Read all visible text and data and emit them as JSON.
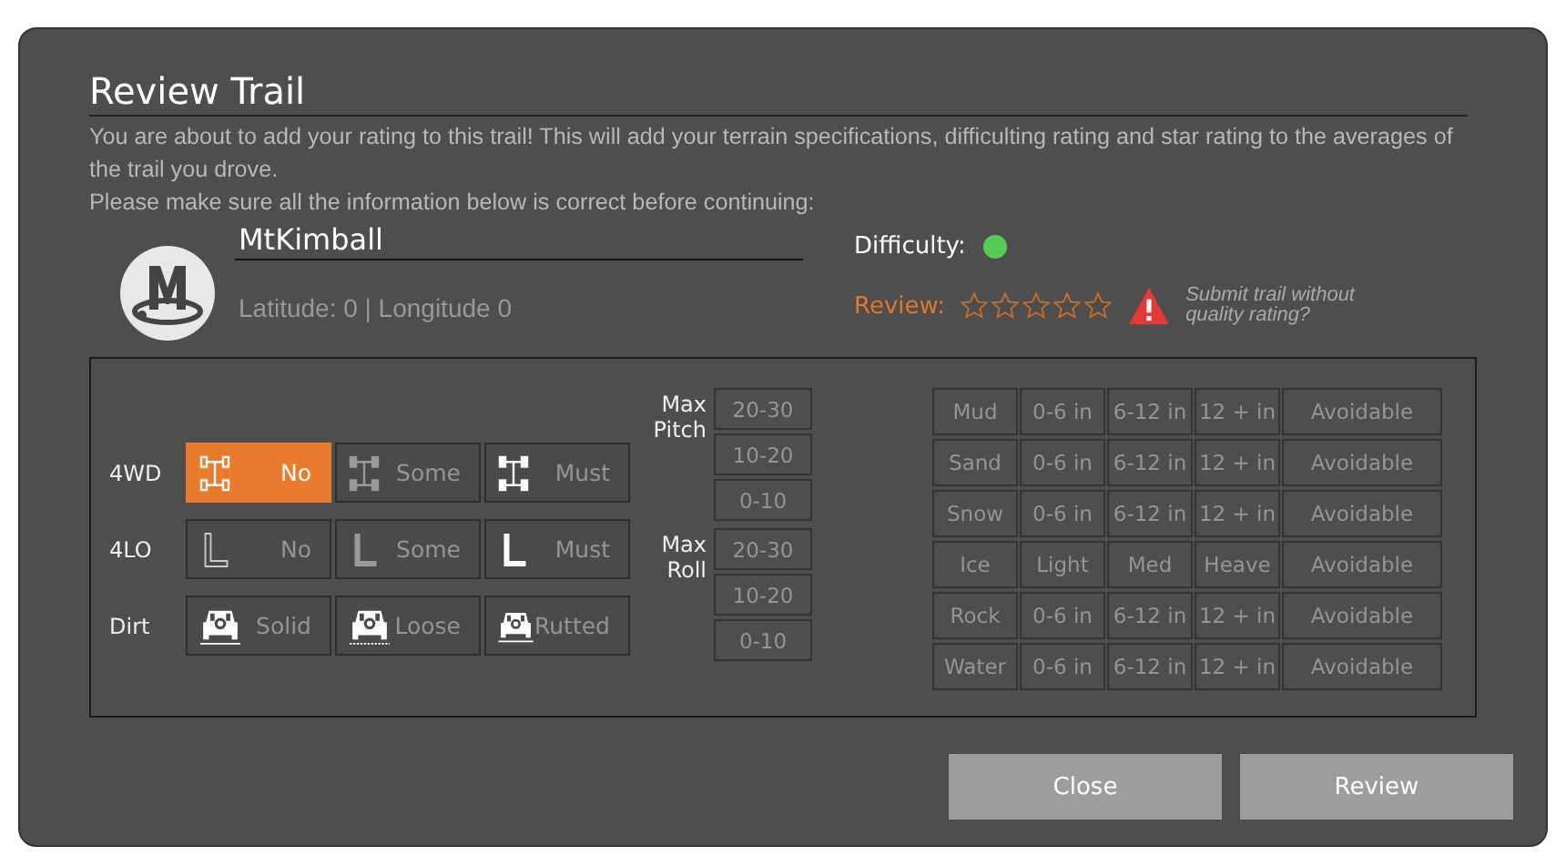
{
  "dialog": {
    "title": "Review Trail",
    "intro": [
      "You are about to add your rating to this trail! This will add your terrain specifications, difficulting rating and star rating to the averages of the trail you drove.",
      "Please make sure all the information below is correct before continuing:"
    ]
  },
  "trail": {
    "name": "MtKimball",
    "location": "Latitude: 0 | Longitude 0",
    "difficulty": {
      "label": "Difficulty:",
      "color": "#55cc55"
    },
    "review_label": "Review:",
    "stars": 0,
    "warning": "Submit trail without quality rating?"
  },
  "requirements": [
    {
      "kind": "axle",
      "label": "4WD",
      "options": [
        {
          "label": "No",
          "selected": true
        },
        {
          "label": "Some",
          "selected": false
        },
        {
          "label": "Must",
          "selected": false
        }
      ]
    },
    {
      "kind": "low",
      "label": "4LO",
      "options": [
        {
          "label": "No",
          "selected": false
        },
        {
          "label": "Some",
          "selected": false
        },
        {
          "label": "Must",
          "selected": false
        }
      ]
    },
    {
      "kind": "dirt",
      "label": "Dirt",
      "options": [
        {
          "label": "Solid",
          "selected": false
        },
        {
          "label": "Loose",
          "selected": false
        },
        {
          "label": "Rutted",
          "selected": false
        }
      ]
    }
  ],
  "angles": [
    {
      "label": "Max Pitch",
      "options": [
        {
          "label": "20-30",
          "selected": false
        },
        {
          "label": "10-20",
          "selected": false
        },
        {
          "label": "0-10",
          "selected": false
        }
      ]
    },
    {
      "label": "Max Roll",
      "options": [
        {
          "label": "20-30",
          "selected": false
        },
        {
          "label": "10-20",
          "selected": false
        },
        {
          "label": "0-10",
          "selected": false
        }
      ]
    }
  ],
  "terrain": [
    {
      "label": "Mud",
      "options": [
        {
          "label": "0-6 in",
          "selected": false
        },
        {
          "label": "6-12 in",
          "selected": false
        },
        {
          "label": "12 + in",
          "selected": false
        },
        {
          "label": "Avoidable",
          "selected": false
        }
      ]
    },
    {
      "label": "Sand",
      "options": [
        {
          "label": "0-6 in",
          "selected": false
        },
        {
          "label": "6-12 in",
          "selected": false
        },
        {
          "label": "12 + in",
          "selected": false
        },
        {
          "label": "Avoidable",
          "selected": false
        }
      ]
    },
    {
      "label": "Snow",
      "options": [
        {
          "label": "0-6 in",
          "selected": false
        },
        {
          "label": "6-12 in",
          "selected": false
        },
        {
          "label": "12 + in",
          "selected": false
        },
        {
          "label": "Avoidable",
          "selected": false
        }
      ]
    },
    {
      "label": "Ice",
      "options": [
        {
          "label": "Light",
          "selected": false
        },
        {
          "label": "Med",
          "selected": false
        },
        {
          "label": "Heave",
          "selected": false
        },
        {
          "label": "Avoidable",
          "selected": false
        }
      ]
    },
    {
      "label": "Rock",
      "options": [
        {
          "label": "0-6 in",
          "selected": false
        },
        {
          "label": "6-12 in",
          "selected": false
        },
        {
          "label": "12 + in",
          "selected": false
        },
        {
          "label": "Avoidable",
          "selected": false
        }
      ]
    },
    {
      "label": "Water",
      "options": [
        {
          "label": "0-6 in",
          "selected": false
        },
        {
          "label": "6-12 in",
          "selected": false
        },
        {
          "label": "12 + in",
          "selected": false
        },
        {
          "label": "Avoidable",
          "selected": false
        }
      ]
    }
  ],
  "buttons": [
    "Close",
    "Review"
  ]
}
